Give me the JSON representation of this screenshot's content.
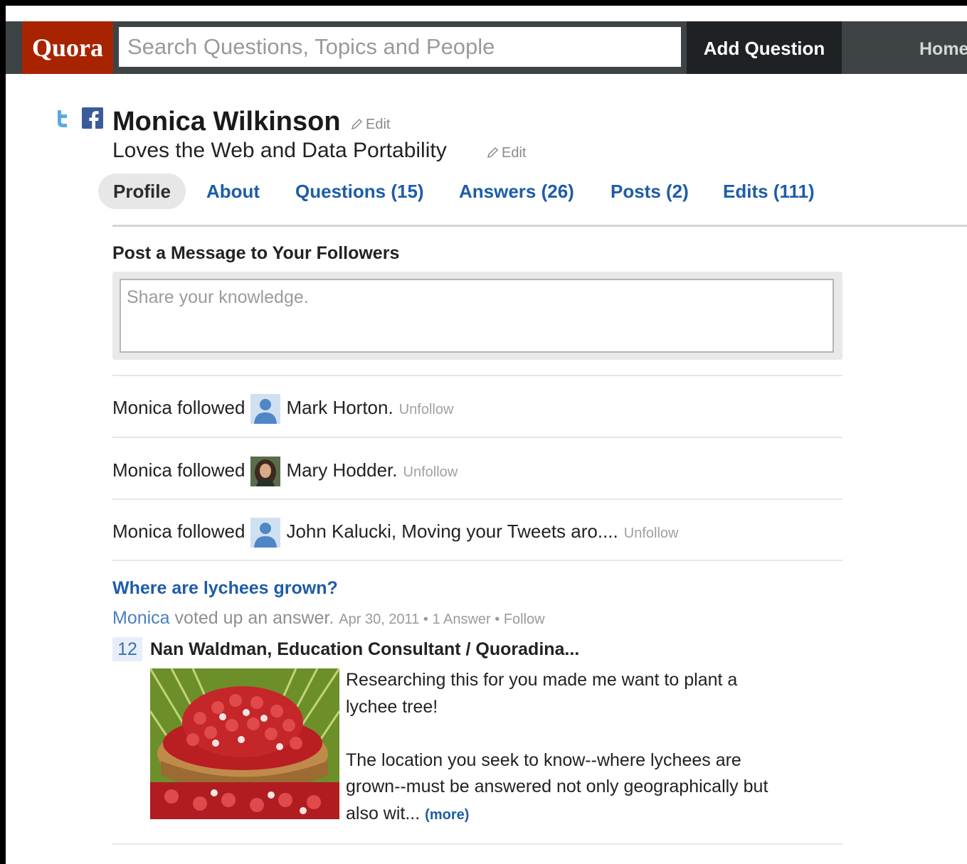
{
  "header": {
    "logo": "Quora",
    "search_placeholder": "Search Questions, Topics and People",
    "add_question": "Add Question",
    "home": "Home"
  },
  "profile": {
    "name": "Monica Wilkinson",
    "name_edit": "Edit",
    "tagline": "Loves the Web and Data Portability",
    "tagline_edit": "Edit"
  },
  "tabs": [
    {
      "label": "Profile",
      "active": true
    },
    {
      "label": "About"
    },
    {
      "label": "Questions (15)"
    },
    {
      "label": "Answers (26)"
    },
    {
      "label": "Posts (2)"
    },
    {
      "label": "Edits (111)"
    }
  ],
  "composer": {
    "title": "Post a Message to Your Followers",
    "placeholder": "Share your knowledge."
  },
  "feed": [
    {
      "prefix": "Monica followed",
      "person": "Mark Horton.",
      "action": "Unfollow",
      "avatar": "default-user-icon"
    },
    {
      "prefix": "Monica followed",
      "person": "Mary Hodder.",
      "action": "Unfollow",
      "avatar": "photo"
    },
    {
      "prefix": "Monica followed",
      "person": "John Kalucki, Moving your Tweets aro....",
      "action": "Unfollow",
      "avatar": "default-user-icon"
    }
  ],
  "question": {
    "title": "Where are lychees grown?",
    "actor": "Monica",
    "activity": " voted up an answer.",
    "date": "Apr 30, 2011",
    "separator": " • ",
    "answers": "1 Answer",
    "follow": "Follow",
    "votes": "12",
    "answer_author": "Nan Waldman, Education Consultant / Quoradina...",
    "answer_para1": "Researching this for you made me want to plant a lychee tree!",
    "answer_para2": "The location you seek to know--where lychees are grown--must be answered not only geographically but also wit...",
    "more": "(more)"
  },
  "colors": {
    "topbar": "#3e4346",
    "logo_bg": "#a82400",
    "add_question_bg": "#1f2224",
    "link": "#1e5ca8"
  }
}
